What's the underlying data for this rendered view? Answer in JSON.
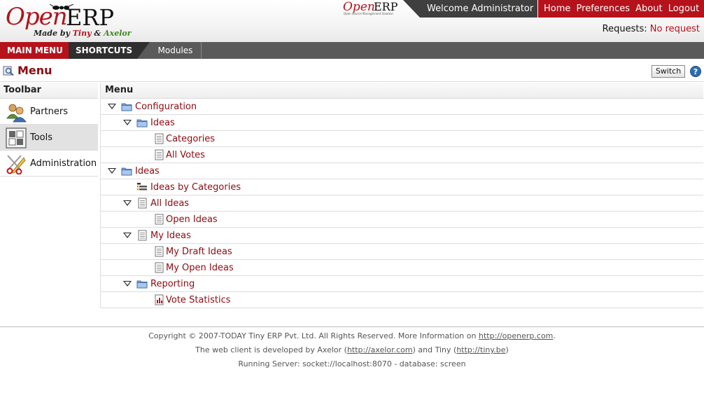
{
  "header": {
    "logo_open": "Open",
    "logo_erp": "ERP",
    "logo_made_by": "Made by",
    "logo_tiny": "Tiny",
    "logo_amp": "&",
    "logo_axelor": "Axelor",
    "mini_logo_open": "Open",
    "mini_logo_erp": "ERP",
    "mini_logo_sub": "Open Source Management Solution",
    "welcome": "Welcome Administrator",
    "links": [
      "Home",
      "Preferences",
      "About",
      "Logout"
    ],
    "requests_label": "Requests:",
    "requests_value": "No request"
  },
  "menubar": {
    "main_menu": "MAIN MENU",
    "shortcuts": "SHORTCUTS",
    "modules": "Modules"
  },
  "page": {
    "title": "Menu",
    "switch_label": "Switch",
    "help": "?"
  },
  "toolbar": {
    "heading": "Toolbar",
    "items": [
      {
        "label": "Partners",
        "icon": "partners-icon",
        "selected": false
      },
      {
        "label": "Tools",
        "icon": "tools-icon",
        "selected": true
      },
      {
        "label": "Administration",
        "icon": "administration-icon",
        "selected": false
      }
    ]
  },
  "menu": {
    "heading": "Menu",
    "rows": [
      {
        "label": "Configuration",
        "level": 0,
        "expanded": true,
        "icon": "folder-icon"
      },
      {
        "label": "Ideas",
        "level": 1,
        "expanded": true,
        "icon": "folder-icon"
      },
      {
        "label": "Categories",
        "level": 2,
        "expanded": null,
        "icon": "document-icon"
      },
      {
        "label": "All Votes",
        "level": 2,
        "expanded": null,
        "icon": "document-icon"
      },
      {
        "label": "Ideas",
        "level": 0,
        "expanded": true,
        "icon": "folder-icon"
      },
      {
        "label": "Ideas by Categories",
        "level": 1,
        "expanded": null,
        "icon": "tree-list-icon"
      },
      {
        "label": "All Ideas",
        "level": 1,
        "expanded": true,
        "icon": "document-icon"
      },
      {
        "label": "Open Ideas",
        "level": 2,
        "expanded": null,
        "icon": "document-icon"
      },
      {
        "label": "My Ideas",
        "level": 1,
        "expanded": true,
        "icon": "document-icon"
      },
      {
        "label": "My Draft Ideas",
        "level": 2,
        "expanded": null,
        "icon": "document-icon"
      },
      {
        "label": "My Open Ideas",
        "level": 2,
        "expanded": null,
        "icon": "document-icon"
      },
      {
        "label": "Reporting",
        "level": 1,
        "expanded": true,
        "icon": "folder-icon"
      },
      {
        "label": "Vote Statistics",
        "level": 2,
        "expanded": null,
        "icon": "chart-report-icon"
      }
    ]
  },
  "footer": {
    "line1_pre": "Copyright © 2007-TODAY Tiny ERP Pvt. Ltd. All Rights Reserved. More Information on ",
    "line1_link": "http://openerp.com",
    "line1_post": ".",
    "line2_pre": "The web client is developed by Axelor (",
    "line2_link1": "http://axelor.com",
    "line2_mid": ") and Tiny (",
    "line2_link2": "http://tiny.be",
    "line2_post": ")",
    "line3": "Running Server: socket://localhost:8070 - database: screen"
  },
  "colors": {
    "brand_red": "#b5121b",
    "dark_bar": "#3f3f3f",
    "menu_link": "#8e0b11"
  }
}
